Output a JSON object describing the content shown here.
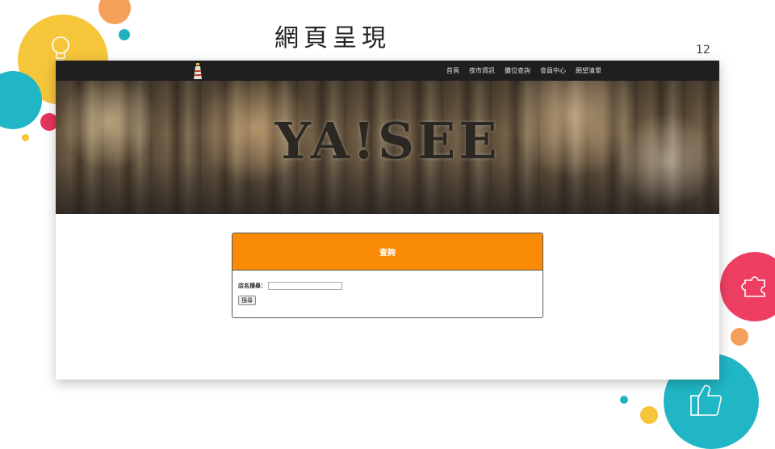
{
  "slide": {
    "title": "網頁呈現",
    "page_number": "12"
  },
  "website": {
    "logo_icon": "lighthouse-icon",
    "nav": [
      "首頁",
      "夜市資訊",
      "攤位查詢",
      "會員中心",
      "願望清單"
    ],
    "hero_title": "YA!SEE",
    "panel": {
      "title": "查詢",
      "store_label": "店名搜尋：",
      "store_value": "",
      "store_placeholder": "",
      "search_button": "搜尋"
    }
  },
  "colors": {
    "panel_header": "#f98b07",
    "navbar": "#1f1f1f",
    "accent_yellow": "#f6c63a",
    "accent_teal": "#20b6c5",
    "accent_pink": "#ee3f62",
    "accent_orange": "#f4a05a"
  },
  "decor_icons": [
    "lightbulb-icon",
    "puzzle-icon",
    "thumbs-up-icon"
  ]
}
